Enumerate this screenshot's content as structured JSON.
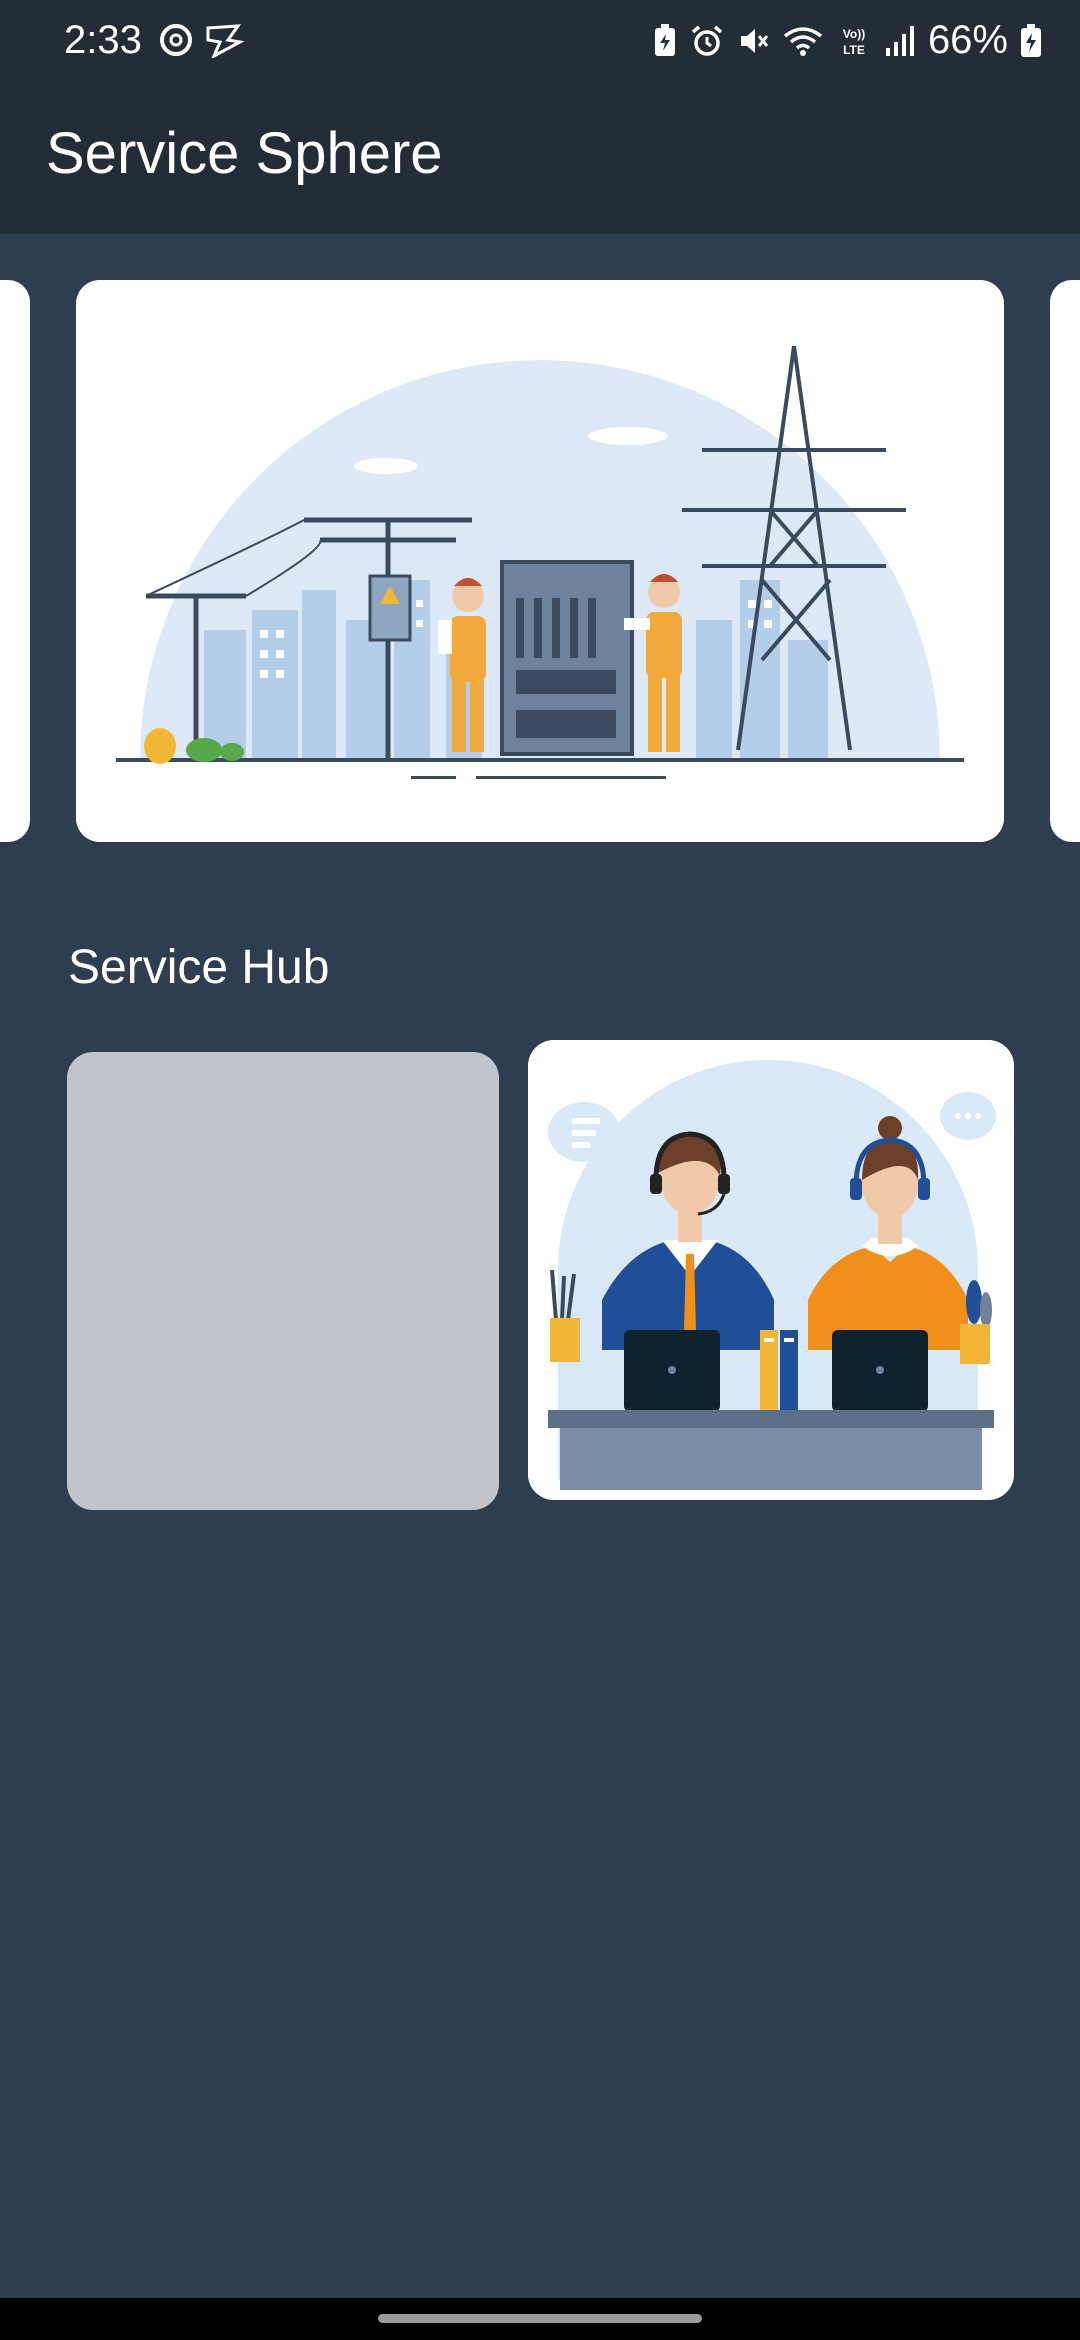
{
  "status_bar": {
    "time": "2:33",
    "battery_percent": "66%",
    "left_icons": [
      "threads-icon",
      "navigation-app-icon"
    ],
    "right_icons": [
      "battery-saver-icon",
      "alarm-icon",
      "mute-icon",
      "wifi-icon",
      "volte-icon",
      "signal-icon",
      "battery-charging-icon"
    ]
  },
  "app_bar": {
    "title": "Service Sphere"
  },
  "carousel": {
    "current_image": "electricians-power-line-illustration",
    "has_previous": true,
    "has_next": true
  },
  "service_hub": {
    "title": "Service Hub",
    "cards": [
      {
        "image": "placeholder-loading"
      },
      {
        "image": "customer-support-agents-illustration"
      }
    ]
  },
  "colors": {
    "background": "#2e3d4f",
    "app_bar": "#222d38",
    "placeholder": "#c1c5cb"
  }
}
